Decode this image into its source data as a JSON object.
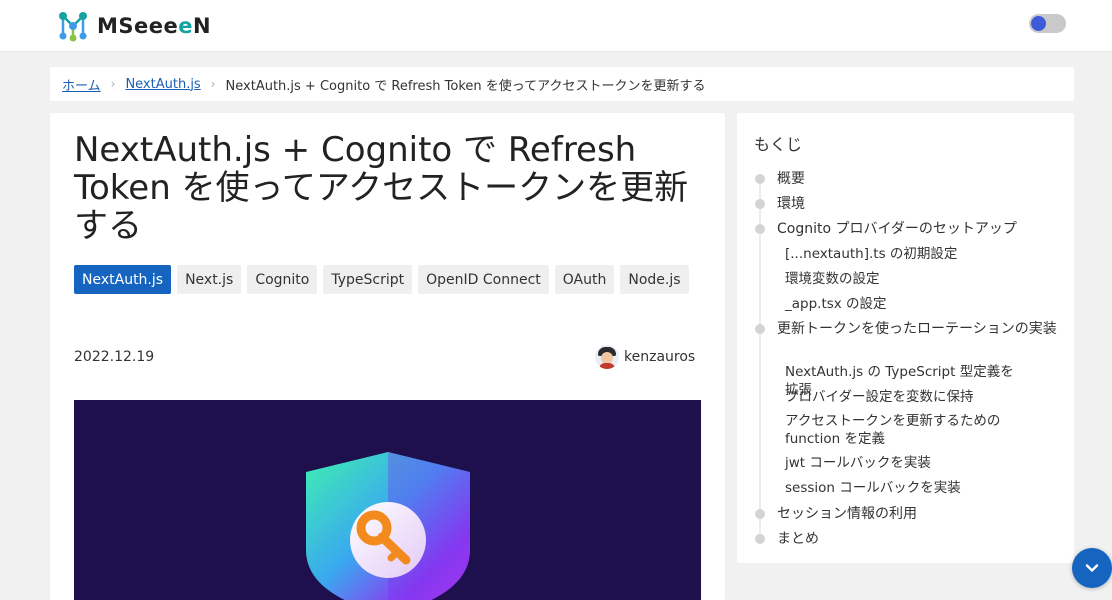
{
  "header": {
    "logo_text_start": "MSeee",
    "logo_text_teal": "e",
    "logo_text_end": "N",
    "logo_icon": "molecule-icon",
    "theme_toggle_icon": "toggle-icon"
  },
  "breadcrumb": {
    "home": "ホーム",
    "category": "NextAuth.js",
    "current": "NextAuth.js + Cognito で Refresh Token を使ってアクセストークンを更新する",
    "separator": "›"
  },
  "article": {
    "title": "NextAuth.js + Cognito で Refresh Token を使ってアクセストークンを更新する",
    "tags": [
      {
        "label": "NextAuth.js",
        "active": true
      },
      {
        "label": "Next.js",
        "active": false
      },
      {
        "label": "Cognito",
        "active": false
      },
      {
        "label": "TypeScript",
        "active": false
      },
      {
        "label": "OpenID Connect",
        "active": false
      },
      {
        "label": "OAuth",
        "active": false
      },
      {
        "label": "Node.js",
        "active": false
      }
    ],
    "date": "2022.12.19",
    "author": "kenzauros",
    "hero_icon": "shield-key-icon"
  },
  "toc": {
    "title": "もくじ",
    "items": [
      {
        "label": "概要",
        "level": 1
      },
      {
        "label": "環境",
        "level": 1
      },
      {
        "label": "Cognito プロバイダーのセットアップ",
        "level": 1
      },
      {
        "label": "[...nextauth].ts の初期設定",
        "level": 2
      },
      {
        "label": "環境変数の設定",
        "level": 2
      },
      {
        "label": "_app.tsx の設定",
        "level": 2
      },
      {
        "label": "更新トークンを使ったローテーションの実装",
        "level": 1
      },
      {
        "label": "NextAuth.js の TypeScript 型定義を拡張",
        "level": 2
      },
      {
        "label": "プロバイダー設定を変数に保持",
        "level": 2
      },
      {
        "label": "アクセストークンを更新するための function を定義",
        "level": 2
      },
      {
        "label": "jwt コールバックを実装",
        "level": 2
      },
      {
        "label": "session コールバックを実装",
        "level": 2
      },
      {
        "label": "セッション情報の利用",
        "level": 1
      },
      {
        "label": "まとめ",
        "level": 1
      }
    ]
  },
  "colors": {
    "accent": "#1565c0",
    "brand_teal": "#14a3a0",
    "hero_bg": "#1e0f4d"
  },
  "scroll_top_icon": "chevron-down-icon"
}
